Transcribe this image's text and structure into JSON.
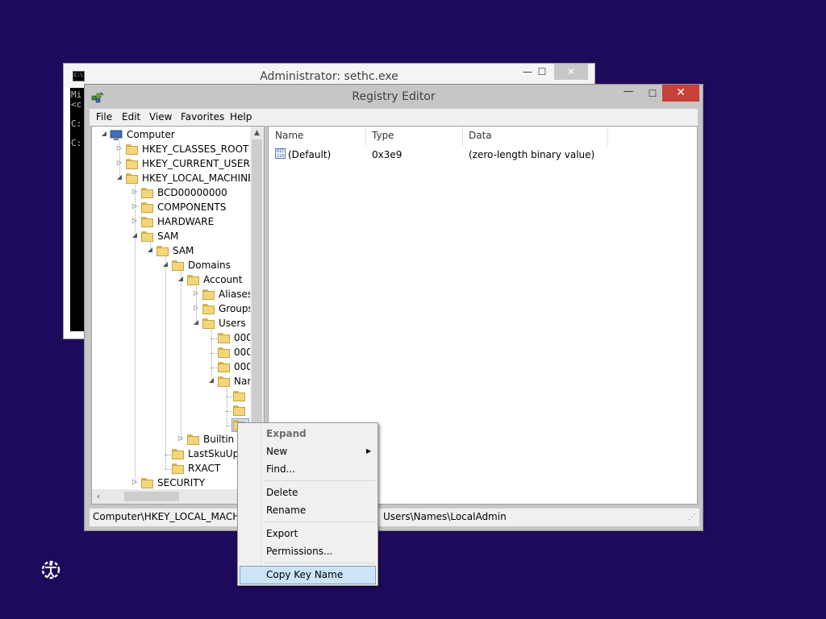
{
  "cmd": {
    "title": "Administrator: sethc.exe",
    "icon_text": "C:\\.",
    "min_label": "—",
    "max_label": "☐",
    "close_label": "✕",
    "lines": [
      "Mi",
      "<c",
      "C:",
      "C:"
    ]
  },
  "regedit": {
    "title": "Registry Editor",
    "min_label": "—",
    "max_label": "☐",
    "close_label": "✕",
    "menu": [
      "File",
      "Edit",
      "View",
      "Favorites",
      "Help"
    ],
    "tree": [
      {
        "label": "Computer",
        "expander": "◢"
      },
      {
        "label": "HKEY_CLASSES_ROOT",
        "expander": "▷"
      },
      {
        "label": "HKEY_CURRENT_USER",
        "expander": "▷"
      },
      {
        "label": "HKEY_LOCAL_MACHINE",
        "expander": "◢"
      },
      {
        "label": "BCD00000000",
        "expander": "▷"
      },
      {
        "label": "COMPONENTS",
        "expander": "▷"
      },
      {
        "label": "HARDWARE",
        "expander": "▷"
      },
      {
        "label": "SAM",
        "expander": "◢"
      },
      {
        "label": "SAM",
        "expander": "◢"
      },
      {
        "label": "Domains",
        "expander": "◢"
      },
      {
        "label": "Account",
        "expander": "◢"
      },
      {
        "label": "Aliases",
        "expander": "▷"
      },
      {
        "label": "Groups",
        "expander": "▷"
      },
      {
        "label": "Users",
        "expander": "◢"
      },
      {
        "label": "000",
        "expander": ""
      },
      {
        "label": "000",
        "expander": ""
      },
      {
        "label": "000",
        "expander": ""
      },
      {
        "label": "Nar",
        "expander": "◢"
      },
      {
        "label": "",
        "expander": ""
      },
      {
        "label": "",
        "expander": ""
      },
      {
        "label": "",
        "expander": ""
      },
      {
        "label": "Builtin",
        "expander": "▷"
      },
      {
        "label": "LastSkuUpg",
        "expander": ""
      },
      {
        "label": "RXACT",
        "expander": ""
      },
      {
        "label": "SECURITY",
        "expander": "▷"
      }
    ],
    "columns": [
      "Name",
      "Type",
      "Data"
    ],
    "values": [
      {
        "name": "(Default)",
        "type": "0x3e9",
        "data": "(zero-length binary value)",
        "icon_text": "011\n110"
      }
    ],
    "status_left": "Computer\\HKEY_LOCAL_MACHIN",
    "status_right": "Users\\Names\\LocalAdmin"
  },
  "context_menu": {
    "items": [
      {
        "label": "Expand",
        "disabled": true
      },
      {
        "label": "New",
        "submenu": true
      },
      {
        "label": "Find..."
      },
      {
        "separator": true
      },
      {
        "label": "Delete"
      },
      {
        "label": "Rename"
      },
      {
        "separator": true
      },
      {
        "label": "Export"
      },
      {
        "label": "Permissions..."
      },
      {
        "separator": true
      },
      {
        "label": "Copy Key Name",
        "highlighted": true
      }
    ],
    "highlight_color": "#cce4f7"
  },
  "colors": {
    "desktop": "#1e0a5c",
    "close_button": "#c7403a"
  }
}
